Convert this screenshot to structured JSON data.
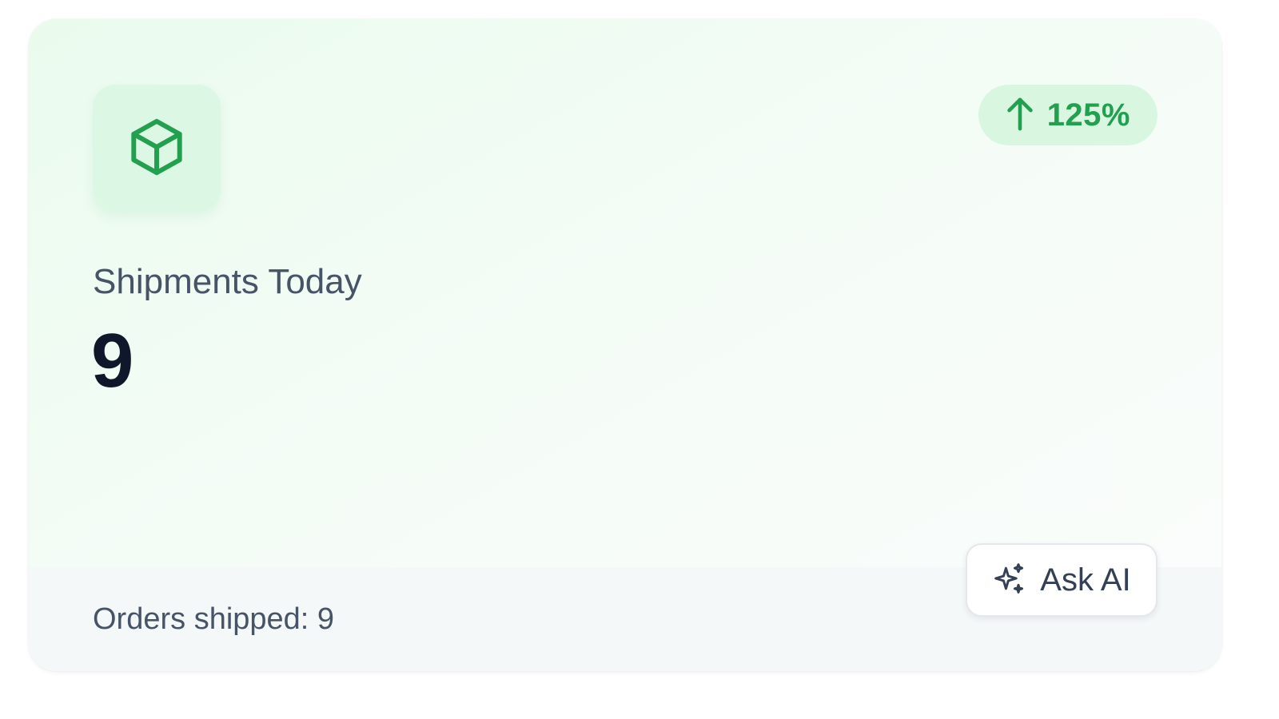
{
  "card": {
    "icon": "box-icon",
    "trend": {
      "icon": "arrow-up-icon",
      "value": "125%",
      "color": "#23a04f"
    },
    "label": "Shipments Today",
    "value": "9",
    "footer_text": "Orders shipped: 9",
    "ask_button": {
      "icon": "sparkle-icon",
      "label": "Ask AI"
    }
  }
}
